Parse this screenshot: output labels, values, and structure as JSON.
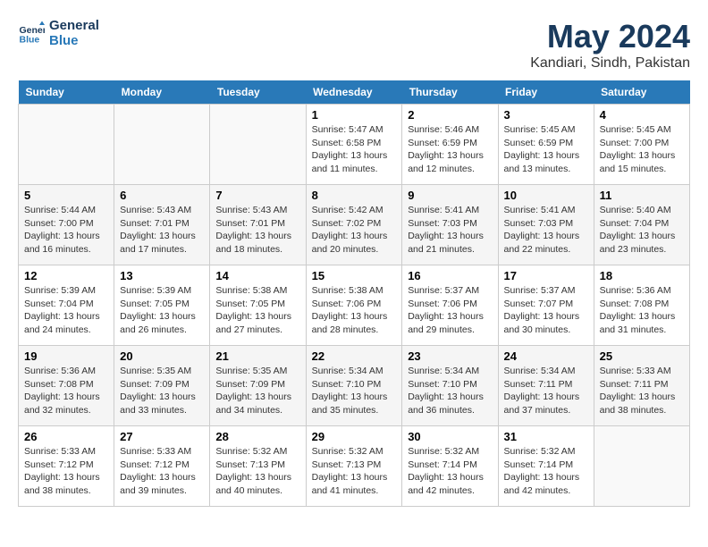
{
  "header": {
    "logo_line1": "General",
    "logo_line2": "Blue",
    "main_title": "May 2024",
    "subtitle": "Kandiari, Sindh, Pakistan"
  },
  "calendar": {
    "days_of_week": [
      "Sunday",
      "Monday",
      "Tuesday",
      "Wednesday",
      "Thursday",
      "Friday",
      "Saturday"
    ],
    "weeks": [
      [
        {
          "day": "",
          "info": ""
        },
        {
          "day": "",
          "info": ""
        },
        {
          "day": "",
          "info": ""
        },
        {
          "day": "1",
          "info": "Sunrise: 5:47 AM\nSunset: 6:58 PM\nDaylight: 13 hours and 11 minutes."
        },
        {
          "day": "2",
          "info": "Sunrise: 5:46 AM\nSunset: 6:59 PM\nDaylight: 13 hours and 12 minutes."
        },
        {
          "day": "3",
          "info": "Sunrise: 5:45 AM\nSunset: 6:59 PM\nDaylight: 13 hours and 13 minutes."
        },
        {
          "day": "4",
          "info": "Sunrise: 5:45 AM\nSunset: 7:00 PM\nDaylight: 13 hours and 15 minutes."
        }
      ],
      [
        {
          "day": "5",
          "info": "Sunrise: 5:44 AM\nSunset: 7:00 PM\nDaylight: 13 hours and 16 minutes."
        },
        {
          "day": "6",
          "info": "Sunrise: 5:43 AM\nSunset: 7:01 PM\nDaylight: 13 hours and 17 minutes."
        },
        {
          "day": "7",
          "info": "Sunrise: 5:43 AM\nSunset: 7:01 PM\nDaylight: 13 hours and 18 minutes."
        },
        {
          "day": "8",
          "info": "Sunrise: 5:42 AM\nSunset: 7:02 PM\nDaylight: 13 hours and 20 minutes."
        },
        {
          "day": "9",
          "info": "Sunrise: 5:41 AM\nSunset: 7:03 PM\nDaylight: 13 hours and 21 minutes."
        },
        {
          "day": "10",
          "info": "Sunrise: 5:41 AM\nSunset: 7:03 PM\nDaylight: 13 hours and 22 minutes."
        },
        {
          "day": "11",
          "info": "Sunrise: 5:40 AM\nSunset: 7:04 PM\nDaylight: 13 hours and 23 minutes."
        }
      ],
      [
        {
          "day": "12",
          "info": "Sunrise: 5:39 AM\nSunset: 7:04 PM\nDaylight: 13 hours and 24 minutes."
        },
        {
          "day": "13",
          "info": "Sunrise: 5:39 AM\nSunset: 7:05 PM\nDaylight: 13 hours and 26 minutes."
        },
        {
          "day": "14",
          "info": "Sunrise: 5:38 AM\nSunset: 7:05 PM\nDaylight: 13 hours and 27 minutes."
        },
        {
          "day": "15",
          "info": "Sunrise: 5:38 AM\nSunset: 7:06 PM\nDaylight: 13 hours and 28 minutes."
        },
        {
          "day": "16",
          "info": "Sunrise: 5:37 AM\nSunset: 7:06 PM\nDaylight: 13 hours and 29 minutes."
        },
        {
          "day": "17",
          "info": "Sunrise: 5:37 AM\nSunset: 7:07 PM\nDaylight: 13 hours and 30 minutes."
        },
        {
          "day": "18",
          "info": "Sunrise: 5:36 AM\nSunset: 7:08 PM\nDaylight: 13 hours and 31 minutes."
        }
      ],
      [
        {
          "day": "19",
          "info": "Sunrise: 5:36 AM\nSunset: 7:08 PM\nDaylight: 13 hours and 32 minutes."
        },
        {
          "day": "20",
          "info": "Sunrise: 5:35 AM\nSunset: 7:09 PM\nDaylight: 13 hours and 33 minutes."
        },
        {
          "day": "21",
          "info": "Sunrise: 5:35 AM\nSunset: 7:09 PM\nDaylight: 13 hours and 34 minutes."
        },
        {
          "day": "22",
          "info": "Sunrise: 5:34 AM\nSunset: 7:10 PM\nDaylight: 13 hours and 35 minutes."
        },
        {
          "day": "23",
          "info": "Sunrise: 5:34 AM\nSunset: 7:10 PM\nDaylight: 13 hours and 36 minutes."
        },
        {
          "day": "24",
          "info": "Sunrise: 5:34 AM\nSunset: 7:11 PM\nDaylight: 13 hours and 37 minutes."
        },
        {
          "day": "25",
          "info": "Sunrise: 5:33 AM\nSunset: 7:11 PM\nDaylight: 13 hours and 38 minutes."
        }
      ],
      [
        {
          "day": "26",
          "info": "Sunrise: 5:33 AM\nSunset: 7:12 PM\nDaylight: 13 hours and 38 minutes."
        },
        {
          "day": "27",
          "info": "Sunrise: 5:33 AM\nSunset: 7:12 PM\nDaylight: 13 hours and 39 minutes."
        },
        {
          "day": "28",
          "info": "Sunrise: 5:32 AM\nSunset: 7:13 PM\nDaylight: 13 hours and 40 minutes."
        },
        {
          "day": "29",
          "info": "Sunrise: 5:32 AM\nSunset: 7:13 PM\nDaylight: 13 hours and 41 minutes."
        },
        {
          "day": "30",
          "info": "Sunrise: 5:32 AM\nSunset: 7:14 PM\nDaylight: 13 hours and 42 minutes."
        },
        {
          "day": "31",
          "info": "Sunrise: 5:32 AM\nSunset: 7:14 PM\nDaylight: 13 hours and 42 minutes."
        },
        {
          "day": "",
          "info": ""
        }
      ]
    ]
  }
}
